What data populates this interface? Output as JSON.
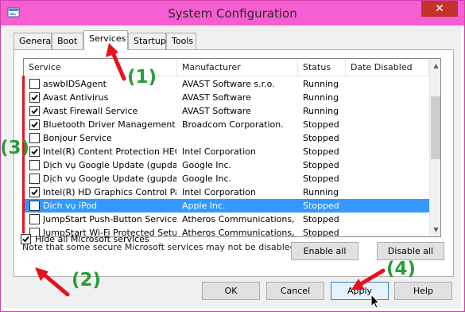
{
  "window": {
    "title": "System Configuration",
    "close_glyph": "✕"
  },
  "tabs": [
    {
      "label": "General"
    },
    {
      "label": "Boot"
    },
    {
      "label": "Services"
    },
    {
      "label": "Startup"
    },
    {
      "label": "Tools"
    }
  ],
  "active_tab": "Services",
  "list": {
    "columns": {
      "service": "Service",
      "manufacturer": "Manufacturer",
      "status": "Status",
      "date_disabled": "Date Disabled"
    },
    "rows": [
      {
        "checked": false,
        "service": "aswbIDSAgent",
        "manufacturer": "AVAST Software s.r.o.",
        "status": "Running",
        "selected": false
      },
      {
        "checked": true,
        "service": "Avast Antivirus",
        "manufacturer": "AVAST Software",
        "status": "Running",
        "selected": false
      },
      {
        "checked": true,
        "service": "Avast Firewall Service",
        "manufacturer": "AVAST Software",
        "status": "Running",
        "selected": false
      },
      {
        "checked": true,
        "service": "Bluetooth Driver Management S...",
        "manufacturer": "Broadcom Corporation.",
        "status": "Stopped",
        "selected": false
      },
      {
        "checked": false,
        "service": "Bonjour Service",
        "manufacturer": "",
        "status": "Stopped",
        "selected": false
      },
      {
        "checked": true,
        "service": "Intel(R) Content Protection HEC...",
        "manufacturer": "Intel Corporation",
        "status": "Stopped",
        "selected": false
      },
      {
        "checked": false,
        "service": "Dịch vụ Google Update (gupdate)",
        "manufacturer": "Google Inc.",
        "status": "Stopped",
        "selected": false
      },
      {
        "checked": false,
        "service": "Dịch vụ Google Update (gupdatem)",
        "manufacturer": "Google Inc.",
        "status": "Stopped",
        "selected": false
      },
      {
        "checked": true,
        "service": "Intel(R) HD Graphics Control Pa...",
        "manufacturer": "Intel Corporation",
        "status": "Running",
        "selected": false
      },
      {
        "checked": false,
        "service": "Dịch vụ iPod",
        "manufacturer": "Apple Inc.",
        "status": "Stopped",
        "selected": true
      },
      {
        "checked": false,
        "service": "JumpStart Push-Button Service",
        "manufacturer": "Atheros Communications, ...",
        "status": "Stopped",
        "selected": false
      },
      {
        "checked": false,
        "service": "JumpStart Wi-Fi Protected Setup",
        "manufacturer": "Atheros Communications, ...",
        "status": "Stopped",
        "selected": false
      }
    ]
  },
  "note": "Note that some secure Microsoft services may not be disabled.",
  "buttons": {
    "enable_all": "Enable all",
    "disable_all": "Disable all",
    "ok": "OK",
    "cancel": "Cancel",
    "apply": "Apply",
    "help": "Help"
  },
  "hide_ms": {
    "label": "Hide all Microsoft services",
    "checked": true
  },
  "annotations": {
    "a1": "(1)",
    "a2": "(2)",
    "a3": "(3)",
    "a4": "(4)"
  },
  "colors": {
    "titlebar": "#f55fd2",
    "close": "#c7312b",
    "selection": "#3399ff",
    "annotation_text": "#2a9d3a",
    "annotation_arrow": "#e8101a"
  },
  "icons": {
    "app": "msconfig-icon",
    "close": "close-icon",
    "checkbox": "checkmark-icon",
    "scroll_up": "scroll-up-icon",
    "scroll_down": "scroll-down-icon",
    "pointer": "mouse-pointer-icon"
  }
}
